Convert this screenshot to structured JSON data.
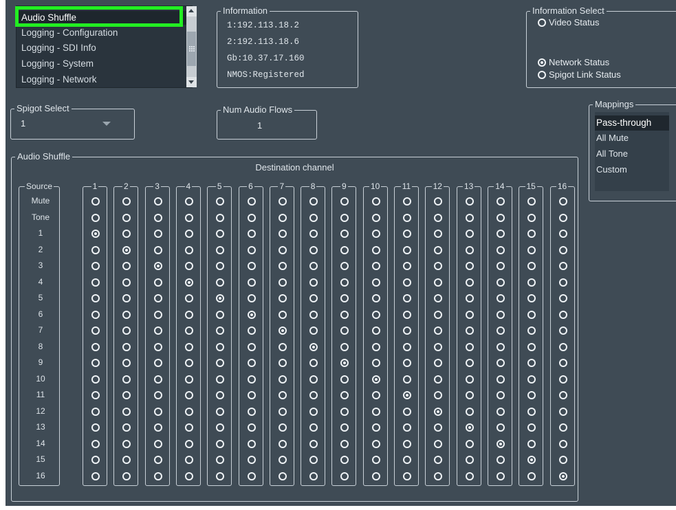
{
  "nav": {
    "items": [
      {
        "label": "Audio Shuffle",
        "selected": true
      },
      {
        "label": "Logging - Configuration",
        "selected": false
      },
      {
        "label": "Logging - SDI Info",
        "selected": false
      },
      {
        "label": "Logging - System",
        "selected": false
      },
      {
        "label": "Logging - Network",
        "selected": false
      }
    ]
  },
  "information": {
    "title": "Information",
    "lines": [
      "1:192.113.18.2",
      "2:192.113.18.6",
      "Gb:10.37.17.160",
      "NMOS:Registered"
    ]
  },
  "info_select": {
    "title": "Information Select",
    "options": [
      {
        "label": "Video Status",
        "checked": false
      },
      {
        "label": "Network Status",
        "checked": true
      },
      {
        "label": "Spigot Link Status",
        "checked": false
      }
    ]
  },
  "spigot": {
    "title": "Spigot Select",
    "value": "1"
  },
  "num_flows": {
    "title": "Num Audio Flows",
    "value": "1"
  },
  "mappings": {
    "title": "Mappings",
    "items": [
      {
        "label": "Pass-through",
        "selected": true
      },
      {
        "label": "All Mute",
        "selected": false
      },
      {
        "label": "All Tone",
        "selected": false
      },
      {
        "label": "Custom",
        "selected": false
      }
    ]
  },
  "shuffle": {
    "title": "Audio Shuffle",
    "dest_label": "Destination channel",
    "source_label": "Source",
    "columns": [
      "1",
      "2",
      "3",
      "4",
      "5",
      "6",
      "7",
      "8",
      "9",
      "10",
      "11",
      "12",
      "13",
      "14",
      "15",
      "16"
    ],
    "rows": [
      "Mute",
      "Tone",
      "1",
      "2",
      "3",
      "4",
      "5",
      "6",
      "7",
      "8",
      "9",
      "10",
      "11",
      "12",
      "13",
      "14",
      "15",
      "16"
    ],
    "selected_source_for_column": [
      "1",
      "2",
      "3",
      "4",
      "5",
      "6",
      "7",
      "8",
      "9",
      "10",
      "11",
      "12",
      "13",
      "14",
      "15",
      "16"
    ]
  },
  "colors": {
    "background": "#3f4b55",
    "highlight": "#22ee22",
    "selected_item": "#1e262d"
  }
}
